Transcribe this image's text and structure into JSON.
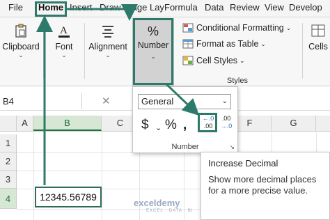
{
  "ribbon_tabs": [
    "File",
    "Home",
    "Insert",
    "Draw",
    "Page Lay",
    "Formula",
    "Data",
    "Review",
    "View",
    "Develop"
  ],
  "ribbon_groups": {
    "clipboard": "Clipboard",
    "font": "Font",
    "alignment": "Alignment",
    "number": "Number",
    "cells": "Cells",
    "styles_group": "Styles"
  },
  "styles_items": {
    "conditional": "Conditional Formatting",
    "format_table": "Format as Table",
    "cell_styles": "Cell Styles"
  },
  "name_box": "B4",
  "columns": [
    "A",
    "B",
    "C",
    "D",
    "E",
    "F",
    "G"
  ],
  "rows": [
    "1",
    "2",
    "3",
    "4"
  ],
  "number_popup": {
    "format_value": "General",
    "currency_symbol": "$",
    "percent_symbol": "%",
    "comma_symbol": "̧",
    "increase_top": "←.0",
    "increase_bottom": ".00",
    "decrease_top": ".00",
    "decrease_bottom": "→.0",
    "group_label": "Number"
  },
  "tooltip": {
    "title": "Increase Decimal",
    "body": "Show more decimal places for a more precise value."
  },
  "cell_b4_value": "12345.56789",
  "watermark": "exceldemy",
  "watermark_sub": "EXCEL · DATA · BI",
  "colors": {
    "highlight": "#2e7a6a",
    "accent_green": "#217346"
  }
}
